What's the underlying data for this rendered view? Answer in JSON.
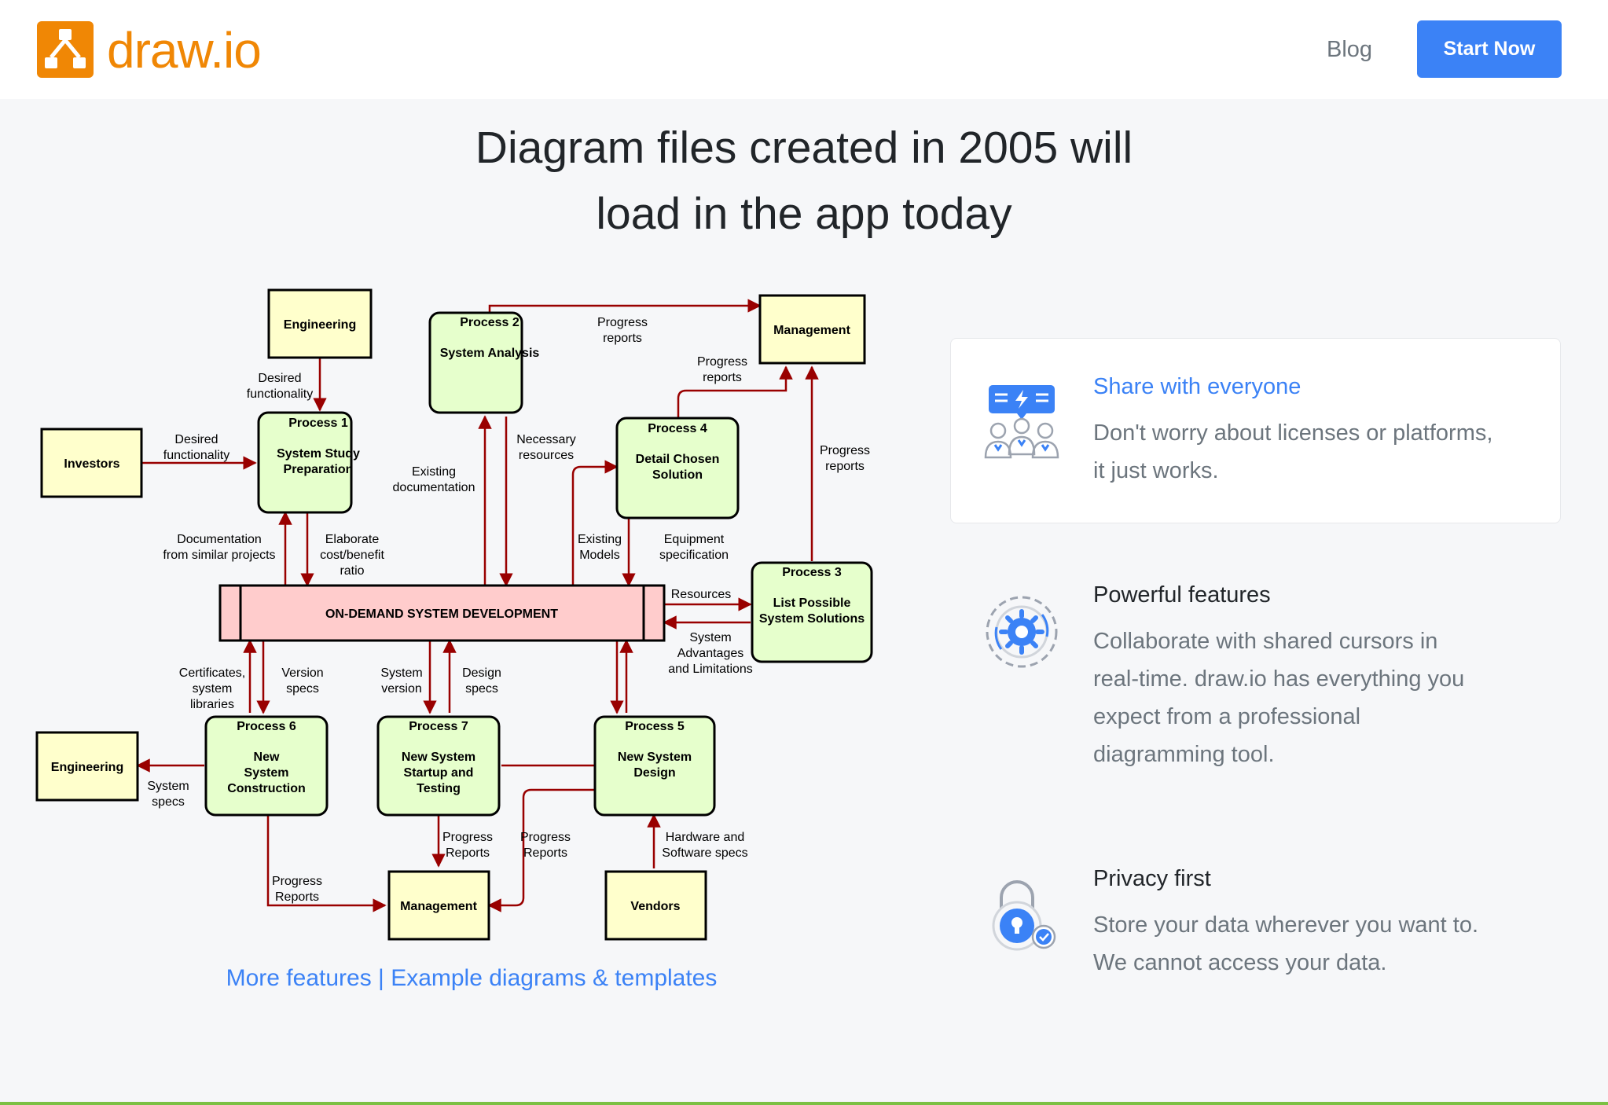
{
  "header": {
    "logo_text": "draw.io",
    "blog_label": "Blog",
    "start_label": "Start Now"
  },
  "headline": {
    "line1": "Diagram files created in 2005 will",
    "line2": "load in the app today"
  },
  "diagram": {
    "central": "ON-DEMAND SYSTEM DEVELOPMENT",
    "entities": {
      "engineering_top": "Engineering",
      "investors": "Investors",
      "management_top": "Management",
      "engineering_left": "Engineering",
      "management_bottom": "Management",
      "vendors": "Vendors"
    },
    "processes": {
      "p1": [
        "Process 1",
        "System Study",
        "Preparation"
      ],
      "p2": [
        "Process 2",
        "System Analysis"
      ],
      "p3": [
        "Process 3",
        "List Possible",
        "System Solutions"
      ],
      "p4": [
        "Process 4",
        "Detail Chosen",
        "Solution"
      ],
      "p5": [
        "Process 5",
        "New System",
        "Design"
      ],
      "p6": [
        "Process 6",
        "New",
        "System",
        "Construction"
      ],
      "p7": [
        "Process 7",
        "New System",
        "Startup and",
        "Testing"
      ]
    },
    "labels": {
      "desired_func_top": [
        "Desired",
        "functionality"
      ],
      "desired_func_left": [
        "Desired",
        "functionality"
      ],
      "progress_reports_top": [
        "Progress",
        "reports"
      ],
      "progress_reports_p4": [
        "Progress",
        "reports"
      ],
      "progress_reports_p3": [
        "Progress",
        "reports"
      ],
      "necessary_resources": [
        "Necessary",
        "resources"
      ],
      "existing_documentation": [
        "Existing",
        "documentation"
      ],
      "documentation": [
        "Documentation",
        "from similar projects"
      ],
      "elaborate": [
        "Elaborate",
        "cost/benefit",
        "ratio"
      ],
      "existing_models": [
        "Existing",
        "Models"
      ],
      "equipment_spec": [
        "Equipment",
        "specification"
      ],
      "resources": [
        "Resources"
      ],
      "system_advantages": [
        "System",
        "Advantages",
        "and Limitations"
      ],
      "certificates": [
        "Certificates,",
        "system",
        "libraries"
      ],
      "version_specs": [
        "Version",
        "specs"
      ],
      "system_version": [
        "System",
        "version"
      ],
      "design_specs": [
        "Design",
        "specs"
      ],
      "system_specs": [
        "System",
        "specs"
      ],
      "progress_reports_p7": [
        "Progress",
        "Reports"
      ],
      "progress_reports_p5": [
        "Progress",
        "Reports"
      ],
      "progress_reports_p6": [
        "Progress",
        "Reports"
      ],
      "hardware_specs": [
        "Hardware and",
        "Software specs"
      ]
    }
  },
  "links": {
    "more_features": "More features",
    "separator": " | ",
    "examples": "Example diagrams & templates"
  },
  "features": [
    {
      "title": "Share with everyone",
      "text_lines": [
        "Don't worry about licenses or platforms,",
        "it just works."
      ],
      "icon": "share-users-icon"
    },
    {
      "title": "Powerful features",
      "text_lines": [
        "Collaborate with shared cursors in",
        "real-time. draw.io has everything you",
        "expect from a professional",
        "diagramming tool."
      ],
      "icon": "gear-features-icon"
    },
    {
      "title": "Privacy first",
      "text_lines": [
        "Store your data wherever you want to.",
        "We cannot access your data."
      ],
      "icon": "padlock-icon"
    }
  ],
  "colors": {
    "brand_orange": "#f08705",
    "accent_blue": "#3b82f6",
    "process_fill": "#e6ffcc",
    "entity_fill": "#ffffcc",
    "central_fill": "#ffcccc",
    "arrow": "#990000"
  }
}
